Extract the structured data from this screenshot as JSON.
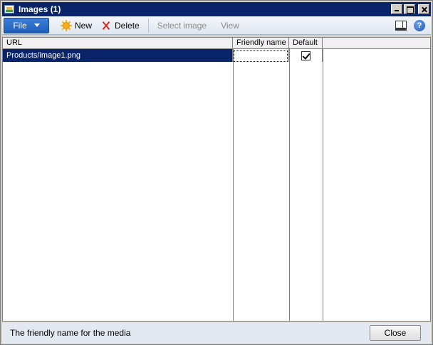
{
  "window": {
    "title": "Images (1)"
  },
  "toolbar": {
    "file_label": "File",
    "new_label": "New",
    "delete_label": "Delete",
    "select_image_label": "Select image",
    "view_label": "View"
  },
  "grid": {
    "columns": [
      "URL",
      "Friendly name",
      "Default"
    ],
    "rows": [
      {
        "url": "Products/image1.png",
        "friendly_name": "",
        "default": true
      }
    ]
  },
  "footer": {
    "status": "The friendly name for the media",
    "close_label": "Close"
  },
  "colors": {
    "titlebar": "#0a246a",
    "selected_row": "#0a246a",
    "file_button": "#2a6ac9"
  }
}
